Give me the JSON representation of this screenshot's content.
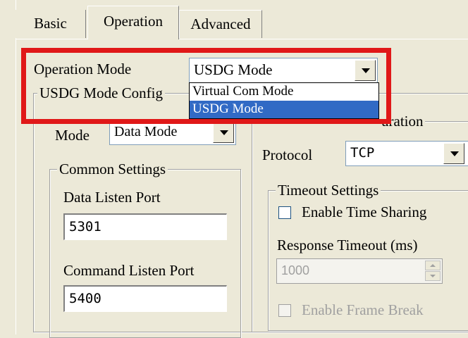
{
  "tabs": [
    {
      "label": "Basic",
      "active": false
    },
    {
      "label": "Operation",
      "active": true
    },
    {
      "label": "Advanced",
      "active": false
    }
  ],
  "operation_mode": {
    "label": "Operation Mode",
    "value": "USDG Mode",
    "options": [
      "Virtual Com Mode",
      "USDG Mode"
    ],
    "selected_index": 1
  },
  "usdg_config": {
    "legend": "USDG Mode Config",
    "mode_label": "Mode",
    "mode_value": "Data Mode"
  },
  "common_settings": {
    "legend": "Common Settings",
    "data_listen_port_label": "Data Listen Port",
    "data_listen_port_value": "5301",
    "command_listen_port_label": "Command Listen Port",
    "command_listen_port_value": "5400"
  },
  "connection_config": {
    "legend_visible": "uration",
    "protocol_label": "Protocol",
    "protocol_value": "TCP"
  },
  "timeout_settings": {
    "legend": "Timeout Settings",
    "enable_time_sharing_label": "Enable Time Sharing",
    "enable_time_sharing_checked": false,
    "response_timeout_label": "Response Timeout (ms)",
    "response_timeout_value": "1000",
    "enable_frame_break_label": "Enable Frame Break",
    "enable_frame_break_checked": false
  },
  "colors": {
    "highlight_box": "#e01818",
    "selection": "#316ac5",
    "window_bg": "#ece9d8"
  }
}
